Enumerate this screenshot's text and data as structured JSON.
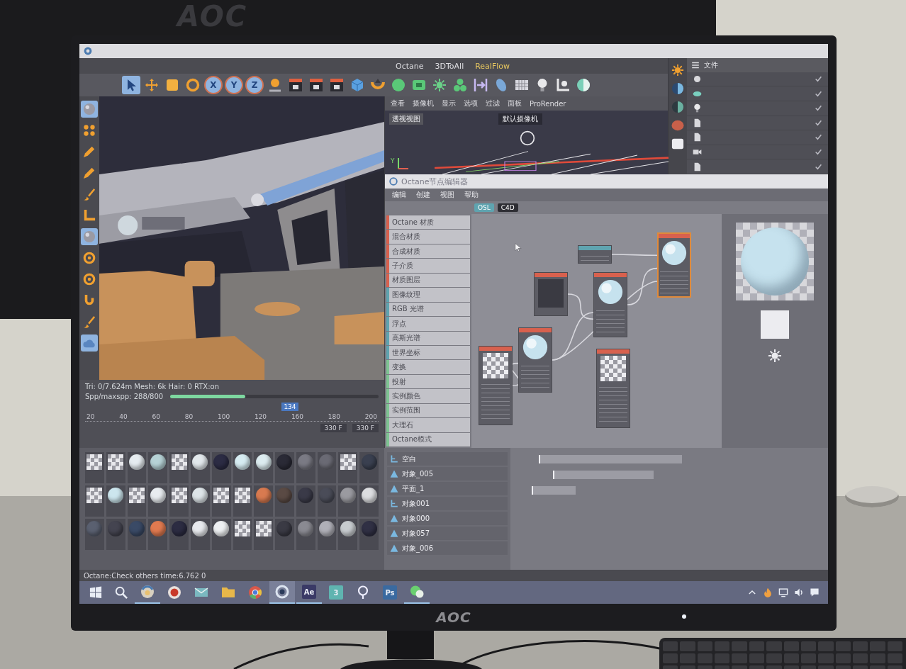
{
  "scene": {
    "back_monitor_logo": "AOC",
    "monitor_logo": "AOC",
    "power_light": true
  },
  "menu_bar": [
    {
      "label": "Octane",
      "highlighted": false
    },
    {
      "label": "3DToAll",
      "highlighted": false
    },
    {
      "label": "RealFlow",
      "highlighted": true
    }
  ],
  "toolbar": [
    {
      "kind": "select",
      "selected": true
    },
    {
      "kind": "move",
      "selected": false
    },
    {
      "kind": "scale",
      "selected": false
    },
    {
      "kind": "rotate",
      "selected": false
    },
    {
      "kind": "axis",
      "label": "X",
      "selected": true
    },
    {
      "kind": "axis",
      "label": "Y",
      "selected": true
    },
    {
      "kind": "axis",
      "label": "Z",
      "selected": true
    },
    {
      "kind": "coord",
      "selected": false
    },
    {
      "kind": "clap",
      "selected": false
    },
    {
      "kind": "clap",
      "selected": false
    },
    {
      "kind": "clap",
      "selected": false
    },
    {
      "kind": "cube",
      "selected": false
    },
    {
      "kind": "bend",
      "selected": false
    },
    {
      "kind": "gsphere",
      "selected": false
    },
    {
      "kind": "gcam",
      "selected": false
    },
    {
      "kind": "gear",
      "selected": false
    },
    {
      "kind": "cluster",
      "selected": false
    },
    {
      "kind": "bracket",
      "selected": false
    },
    {
      "kind": "leaf",
      "selected": false
    },
    {
      "kind": "grid",
      "selected": false
    },
    {
      "kind": "bulb",
      "selected": false
    },
    {
      "kind": "floor",
      "selected": false
    },
    {
      "kind": "sky",
      "selected": false
    }
  ],
  "tool_strip": [
    {
      "kind": "ball",
      "selected": true
    },
    {
      "kind": "dots",
      "selected": false
    },
    {
      "kind": "pen",
      "selected": false
    },
    {
      "kind": "pen",
      "selected": false
    },
    {
      "kind": "brush",
      "selected": false
    },
    {
      "kind": "lshape",
      "selected": false
    },
    {
      "kind": "ball",
      "selected": true
    },
    {
      "kind": "ring",
      "selected": false
    },
    {
      "kind": "ring",
      "selected": false
    },
    {
      "kind": "hook",
      "selected": false
    },
    {
      "kind": "brush",
      "selected": false
    },
    {
      "kind": "cloud",
      "selected": true
    }
  ],
  "perspective_view": {
    "menu": [
      "查看",
      "摄像机",
      "显示",
      "选项",
      "过滤",
      "面板",
      "ProRender"
    ],
    "camera": "默认摄像机",
    "title": "透视视图",
    "axis_label": "Y"
  },
  "object_manager": {
    "header": "文件",
    "side_icons": [
      {
        "kind": "sun"
      },
      {
        "kind": "dome"
      },
      {
        "kind": "dome2"
      },
      {
        "kind": "blob"
      },
      {
        "kind": "square"
      }
    ],
    "rows": [
      {
        "kind": "tag"
      },
      {
        "kind": "skyobj"
      },
      {
        "kind": "bulb"
      },
      {
        "kind": "file"
      },
      {
        "kind": "file"
      },
      {
        "kind": "camera"
      },
      {
        "kind": "file"
      }
    ]
  },
  "render_stats": {
    "geometry": "Tri: 0/7.624m Mesh: 6k Hair: 0 RTX:on",
    "samples": "Spp/maxspp: 288/800",
    "level": 0.36
  },
  "timeline": {
    "ticks": [
      "20",
      "40",
      "60",
      "80",
      "100",
      "120",
      "160",
      "180",
      "200"
    ],
    "current": "134",
    "level": 0.67,
    "end_fields": [
      "330 F",
      "330 F"
    ]
  },
  "materials": [
    {
      "kind": "checker"
    },
    {
      "kind": "checker"
    },
    {
      "kind": "sphere",
      "color": "#e6ecf0"
    },
    {
      "kind": "sphere",
      "color": "#b6d2d6"
    },
    {
      "kind": "checker"
    },
    {
      "kind": "sphere",
      "color": "#e2e8ec"
    },
    {
      "kind": "sphere",
      "color": "#2c2c44"
    },
    {
      "kind": "sphere",
      "color": "#d6ecf2"
    },
    {
      "kind": "sphere",
      "color": "#dcecf0"
    },
    {
      "kind": "sphere",
      "color": "#2a2a36"
    },
    {
      "kind": "sphere",
      "color": "#7a7a84"
    },
    {
      "kind": "sphere",
      "color": "#6a6a74"
    },
    {
      "kind": "checker"
    },
    {
      "kind": "sphere",
      "color": "#3a4050"
    },
    {
      "kind": "checker"
    },
    {
      "kind": "sphere",
      "color": "#cce6ee"
    },
    {
      "kind": "checker"
    },
    {
      "kind": "sphere",
      "color": "#e8ecf0"
    },
    {
      "kind": "checker"
    },
    {
      "kind": "sphere",
      "color": "#dde4e8"
    },
    {
      "kind": "checker"
    },
    {
      "kind": "checker"
    },
    {
      "kind": "sphere",
      "color": "#d87a50"
    },
    {
      "kind": "sphere",
      "color": "#5a4a44"
    },
    {
      "kind": "sphere",
      "color": "#3a3a48"
    },
    {
      "kind": "sphere",
      "color": "#4a4c58"
    },
    {
      "kind": "sphere",
      "color": "#9a9aa0"
    },
    {
      "kind": "sphere",
      "color": "#dcdde0"
    },
    {
      "kind": "sphere",
      "color": "#5a6070"
    },
    {
      "kind": "sphere",
      "color": "#444450"
    },
    {
      "kind": "sphere",
      "color": "#3a4a66"
    },
    {
      "kind": "sphere",
      "color": "#e07a50"
    },
    {
      "kind": "sphere",
      "color": "#2c2c42"
    },
    {
      "kind": "sphere",
      "color": "#e8eaee"
    },
    {
      "kind": "sphere",
      "color": "#eef0f2"
    },
    {
      "kind": "checker"
    },
    {
      "kind": "checker"
    },
    {
      "kind": "sphere",
      "color": "#3a3a44"
    },
    {
      "kind": "sphere",
      "color": "#8a8a92"
    },
    {
      "kind": "sphere",
      "color": "#b0b0b8"
    },
    {
      "kind": "sphere",
      "color": "#c8ccd0"
    },
    {
      "kind": "sphere",
      "color": "#303044"
    }
  ],
  "node_editor": {
    "title": "Octane节点编辑器",
    "menu": [
      "编辑",
      "创建",
      "视图",
      "帮助"
    ],
    "tags": [
      {
        "label": "OSL",
        "color": "#5fa4b0"
      },
      {
        "label": "C4D",
        "color": "#2e2e34"
      }
    ],
    "node_types": [
      {
        "label": "Octane 材质",
        "color": "#d8614e"
      },
      {
        "label": "混合材质",
        "color": "#d8614e"
      },
      {
        "label": "合成材质",
        "color": "#d8614e"
      },
      {
        "label": "子介质",
        "color": "#d8614e"
      },
      {
        "label": "材质图层",
        "color": "#d8614e"
      },
      {
        "label": "图像纹理",
        "color": "#5fa4b0"
      },
      {
        "label": "RGB 光谱",
        "color": "#5fa4b0"
      },
      {
        "label": "浮点",
        "color": "#5fa4b0"
      },
      {
        "label": "高斯光谱",
        "color": "#5fa4b0"
      },
      {
        "label": "世界坐标",
        "color": "#5fa4b0"
      },
      {
        "label": "变换",
        "color": "#7fc493"
      },
      {
        "label": "投射",
        "color": "#7fc493"
      },
      {
        "label": "实例颜色",
        "color": "#7fc493"
      },
      {
        "label": "实例范围",
        "color": "#7fc493"
      },
      {
        "label": "大理石",
        "color": "#7fc493"
      },
      {
        "label": "Octane模式",
        "color": "#7fc493"
      }
    ],
    "nodes": [
      {
        "kind": "material",
        "selected": true
      },
      {
        "kind": "input",
        "selected": false
      },
      {
        "kind": "value",
        "selected": false
      },
      {
        "kind": "material",
        "selected": false
      },
      {
        "kind": "material",
        "selected": false
      },
      {
        "kind": "texture",
        "selected": false
      },
      {
        "kind": "texture",
        "selected": false
      }
    ]
  },
  "layers": [
    {
      "name": "空白",
      "kind": "null"
    },
    {
      "name": "对象_005",
      "kind": "mesh"
    },
    {
      "name": "平面_1",
      "kind": "mesh"
    },
    {
      "name": "对象001",
      "kind": "null"
    },
    {
      "name": "对象000",
      "kind": "mesh"
    },
    {
      "name": "对象057",
      "kind": "mesh"
    },
    {
      "name": "对象_006",
      "kind": "mesh"
    }
  ],
  "status_bar": "Octane:Check others time:6.762 0",
  "taskbar": {
    "apps": [
      {
        "kind": "cinema",
        "running": true,
        "selected": false
      },
      {
        "kind": "record",
        "running": false,
        "selected": false
      },
      {
        "kind": "mail",
        "running": false,
        "selected": false
      },
      {
        "kind": "folder",
        "running": false,
        "selected": false
      },
      {
        "kind": "chrome",
        "running": false,
        "selected": false
      },
      {
        "kind": "octane",
        "running": true,
        "selected": true
      },
      {
        "kind": "letter",
        "label": "Ae",
        "color": "#3a3a66",
        "running": true,
        "selected": false
      },
      {
        "kind": "letter",
        "label": "3",
        "color": "#5fb4b0",
        "running": false,
        "selected": false
      },
      {
        "kind": "pin",
        "running": false,
        "selected": false
      },
      {
        "kind": "letter",
        "label": "Ps",
        "color": "#3a6aa0",
        "running": false,
        "selected": false
      },
      {
        "kind": "chat",
        "running": true,
        "selected": false
      }
    ]
  }
}
